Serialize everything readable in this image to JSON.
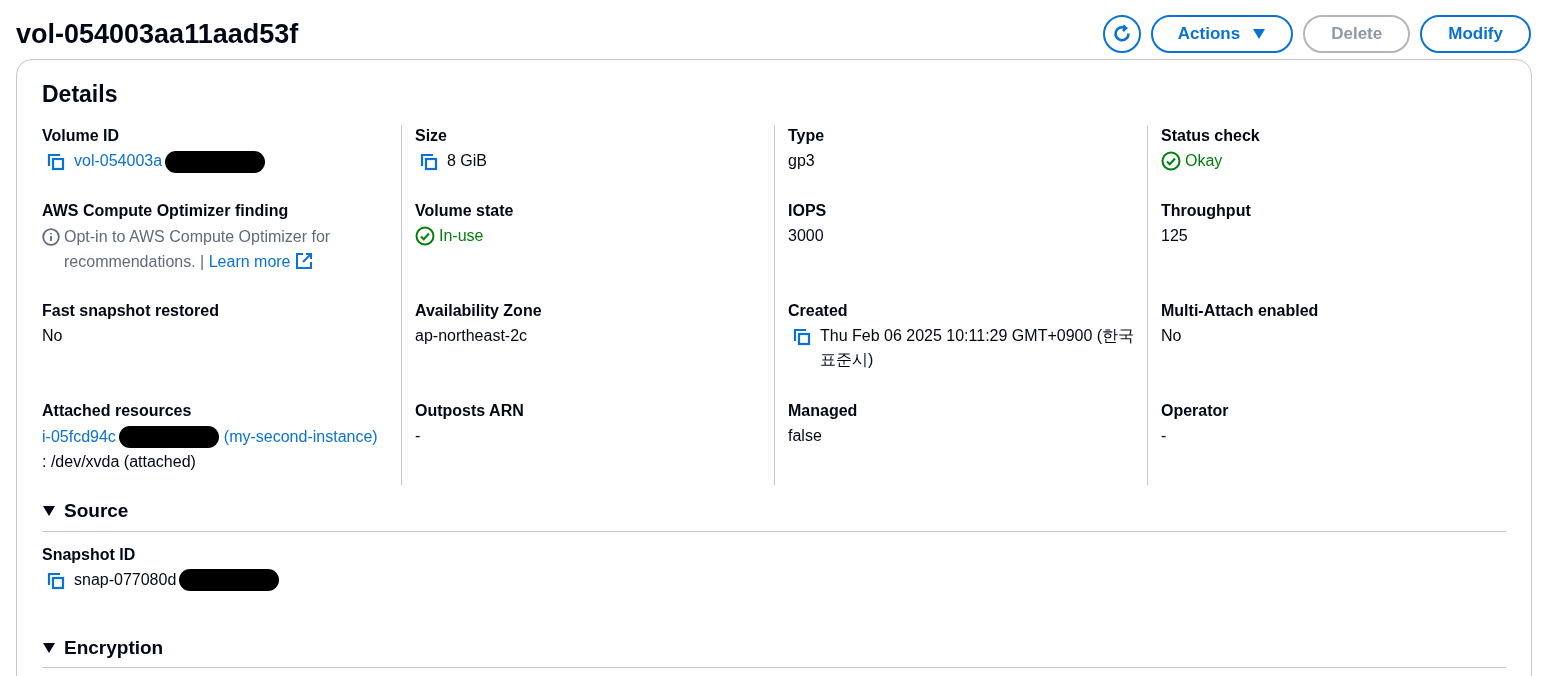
{
  "title": "vol-054003aa11aad53f",
  "actions": [
    {
      "kind": "refresh",
      "disabled": false
    },
    {
      "kind": "dropdown",
      "label": "Actions",
      "disabled": false
    },
    {
      "kind": "plain",
      "label": "Delete",
      "disabled": true
    },
    {
      "kind": "plain",
      "label": "Modify",
      "disabled": false
    }
  ],
  "details": {
    "heading": "Details",
    "fields": [
      {
        "label": "Volume ID",
        "kind": "copy-link",
        "value": "vol-054003a",
        "redacted": true
      },
      {
        "label": "Size",
        "kind": "copy",
        "value": "8 GiB"
      },
      {
        "label": "Type",
        "kind": "text",
        "value": "gp3"
      },
      {
        "label": "Status check",
        "kind": "status",
        "value": "Okay"
      },
      {
        "label": "AWS Compute Optimizer finding",
        "kind": "info",
        "value": "Opt-in to AWS Compute Optimizer for recommendations.",
        "separator": "|",
        "link": "Learn more"
      },
      {
        "label": "Volume state",
        "kind": "status",
        "value": "In-use"
      },
      {
        "label": "IOPS",
        "kind": "text",
        "value": "3000"
      },
      {
        "label": "Throughput",
        "kind": "text",
        "value": "125"
      },
      {
        "label": "Fast snapshot restored",
        "kind": "text",
        "value": "No"
      },
      {
        "label": "Availability Zone",
        "kind": "text",
        "value": "ap-northeast-2c"
      },
      {
        "label": "Created",
        "kind": "copy",
        "value": "Thu Feb 06 2025 10:11:29 GMT+0900 (한국 표준시)"
      },
      {
        "label": "Multi-Attach enabled",
        "kind": "text",
        "value": "No"
      },
      {
        "label": "Attached resources",
        "kind": "attached",
        "value": "i-05fcd94c",
        "redacted": true,
        "link": "(my-second-instance)",
        "suffix": ": /dev/xvda (attached)"
      },
      {
        "label": "Outposts ARN",
        "kind": "text",
        "value": "-"
      },
      {
        "label": "Managed",
        "kind": "text",
        "value": "false"
      },
      {
        "label": "Operator",
        "kind": "text",
        "value": "-"
      }
    ]
  },
  "sections": [
    {
      "title": "Source",
      "expanded": true,
      "fields": [
        {
          "label": "Snapshot ID",
          "kind": "copy",
          "value": "snap-077080d",
          "redacted": true
        }
      ]
    },
    {
      "title": "Encryption",
      "expanded": true
    }
  ]
}
